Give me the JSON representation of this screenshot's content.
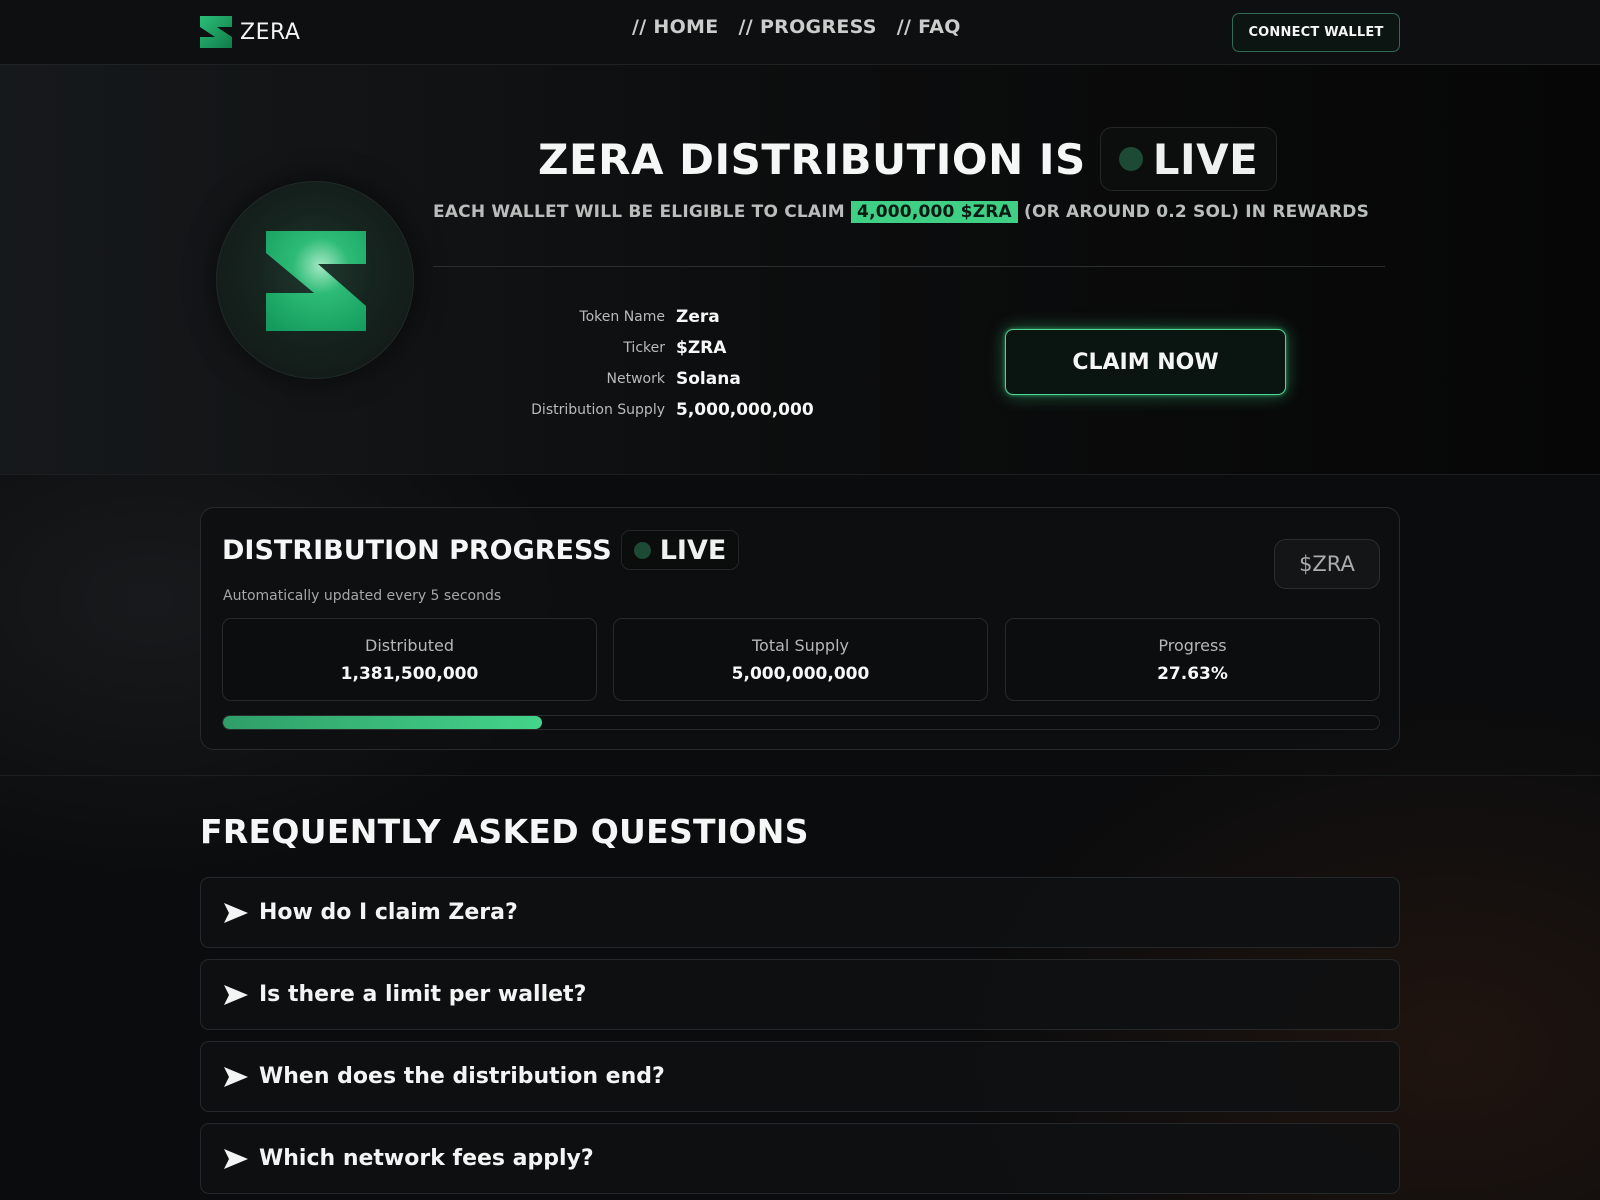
{
  "header": {
    "logo_text": "ZERA",
    "nav": [
      {
        "label": "// HOME"
      },
      {
        "label": "// PROGRESS"
      },
      {
        "label": "// FAQ"
      }
    ],
    "connect_label": "CONNECT WALLET"
  },
  "hero": {
    "title": "ZERA DISTRIBUTION IS",
    "live_label": "LIVE",
    "subtitle_before": "EACH WALLET WILL BE ELIGIBLE TO CLAIM",
    "subtitle_highlight": "4,000,000 $ZRA",
    "subtitle_after": "(OR AROUND 0.2 SOL) IN REWARDS",
    "info": [
      {
        "label": "Token Name",
        "value": "Zera"
      },
      {
        "label": "Ticker",
        "value": "$ZRA"
      },
      {
        "label": "Network",
        "value": "Solana"
      },
      {
        "label": "Distribution Supply",
        "value": "5,000,000,000"
      }
    ],
    "claim_label": "CLAIM NOW"
  },
  "progress": {
    "title": "DISTRIBUTION PROGRESS",
    "live_label": "LIVE",
    "subtitle": "Automatically updated every 5 seconds",
    "badge": "$ZRA",
    "stats": [
      {
        "label": "Distributed",
        "value": "1,381,500,000"
      },
      {
        "label": "Total Supply",
        "value": "5,000,000,000"
      },
      {
        "label": "Progress",
        "value": "27.63%"
      }
    ],
    "fraction": 0.2763
  },
  "faq": {
    "title": "FREQUENTLY ASKED QUESTIONS",
    "items": [
      {
        "question": "How do I claim Zera?"
      },
      {
        "question": "Is there a limit per wallet?"
      },
      {
        "question": "When does the distribution end?"
      },
      {
        "question": "Which network fees apply?"
      }
    ]
  },
  "colors": {
    "accent": "#3fcf85",
    "background": "#0b0c0d",
    "live_dot": "#1d4a35"
  },
  "icons": {
    "logo": "zera-logo-icon",
    "live": "live-dot-icon",
    "faq": "arrow-right-icon"
  }
}
